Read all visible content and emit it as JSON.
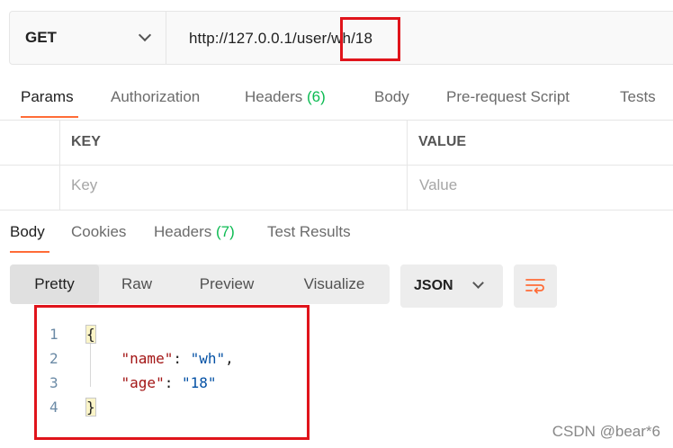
{
  "request": {
    "method": "GET",
    "url": "http://127.0.0.1/user/wh/18"
  },
  "request_tabs": [
    {
      "label": "Params"
    },
    {
      "label": "Authorization"
    },
    {
      "label": "Headers",
      "count": "(6)"
    },
    {
      "label": "Body"
    },
    {
      "label": "Pre-request Script"
    },
    {
      "label": "Tests"
    }
  ],
  "params_table": {
    "headers": [
      "KEY",
      "VALUE"
    ],
    "placeholders": [
      "Key",
      "Value"
    ]
  },
  "response_tabs": [
    {
      "label": "Body"
    },
    {
      "label": "Cookies"
    },
    {
      "label": "Headers",
      "count": "(7)"
    },
    {
      "label": "Test Results"
    }
  ],
  "view_modes": [
    "Pretty",
    "Raw",
    "Preview",
    "Visualize"
  ],
  "format": "JSON",
  "code": {
    "line_numbers": [
      "1",
      "2",
      "3",
      "4"
    ],
    "open_brace": "{",
    "close_brace": "}",
    "line2": {
      "key": "\"name\"",
      "sep": ": ",
      "value": "\"wh\"",
      "end": ","
    },
    "line3": {
      "key": "\"age\"",
      "sep": ": ",
      "value": "\"18\""
    }
  },
  "watermark": "CSDN @bear*6",
  "colors": {
    "accent": "#ff6c37",
    "count": "#0cbb52",
    "highlight": "#e0141b"
  }
}
